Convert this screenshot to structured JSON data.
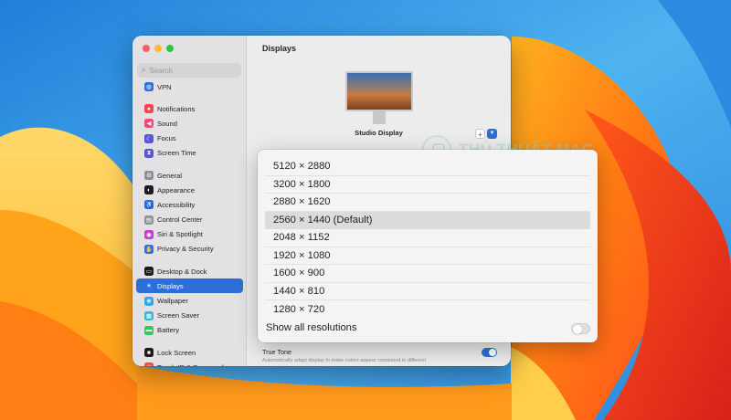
{
  "sidebar": {
    "search_placeholder": "Search",
    "items": [
      {
        "label": "VPN",
        "icon": "vpn-icon",
        "color": "#2c6fe0",
        "glyph": "◍"
      },
      {
        "label": "Notifications",
        "icon": "bell-icon",
        "color": "#f04a4a",
        "glyph": "●"
      },
      {
        "label": "Sound",
        "icon": "speaker-icon",
        "color": "#f04a7a",
        "glyph": "◀"
      },
      {
        "label": "Focus",
        "icon": "moon-icon",
        "color": "#5b55d6",
        "glyph": "☾"
      },
      {
        "label": "Screen Time",
        "icon": "hourglass-icon",
        "color": "#5b55d6",
        "glyph": "⧗"
      },
      {
        "label": "General",
        "icon": "gear-icon",
        "color": "#8e8e93",
        "glyph": "⚙"
      },
      {
        "label": "Appearance",
        "icon": "appearance-icon",
        "color": "#1c1c1e",
        "glyph": "◐"
      },
      {
        "label": "Accessibility",
        "icon": "accessibility-icon",
        "color": "#2c6fe0",
        "glyph": "♿"
      },
      {
        "label": "Control Center",
        "icon": "control-center-icon",
        "color": "#8e8e93",
        "glyph": "▤"
      },
      {
        "label": "Siri & Spotlight",
        "icon": "siri-icon",
        "color": "#c43ec9",
        "glyph": "◉"
      },
      {
        "label": "Privacy & Security",
        "icon": "hand-icon",
        "color": "#2c6fe0",
        "glyph": "✋"
      },
      {
        "label": "Desktop & Dock",
        "icon": "dock-icon",
        "color": "#1c1c1e",
        "glyph": "▭"
      },
      {
        "label": "Displays",
        "icon": "sun-icon",
        "color": "#2c6fe0",
        "glyph": "☀"
      },
      {
        "label": "Wallpaper",
        "icon": "wallpaper-icon",
        "color": "#37a6e8",
        "glyph": "❋"
      },
      {
        "label": "Screen Saver",
        "icon": "screensaver-icon",
        "color": "#37b6d8",
        "glyph": "▦"
      },
      {
        "label": "Battery",
        "icon": "battery-icon",
        "color": "#34c759",
        "glyph": "▬"
      },
      {
        "label": "Lock Screen",
        "icon": "lock-icon",
        "color": "#1c1c1e",
        "glyph": "■"
      },
      {
        "label": "Touch ID & Password",
        "icon": "fingerprint-icon",
        "color": "#f04a4a",
        "glyph": "◎"
      }
    ],
    "active": "Displays"
  },
  "main": {
    "title": "Displays",
    "display_name": "Studio Display",
    "add_label": "+",
    "true_tone": {
      "label": "True Tone",
      "description": "Automatically adapt display to make colors appear consistent in different",
      "enabled": true
    }
  },
  "watermark": {
    "text": "THỦ THUẬT MAC"
  },
  "resolutions": {
    "options": [
      "5120 × 2880",
      "3200 × 1800",
      "2880 × 1620",
      "2560 × 1440 (Default)",
      "2048 × 1152",
      "1920 × 1080",
      "1600 × 900",
      "1440 × 810",
      "1280 × 720"
    ],
    "selected_index": 3,
    "show_all_label": "Show all resolutions",
    "show_all_enabled": false
  },
  "colors": {
    "accent": "#2d6fd6",
    "window_bg": "#ececec",
    "sidebar_bg": "#e3e1e3"
  }
}
